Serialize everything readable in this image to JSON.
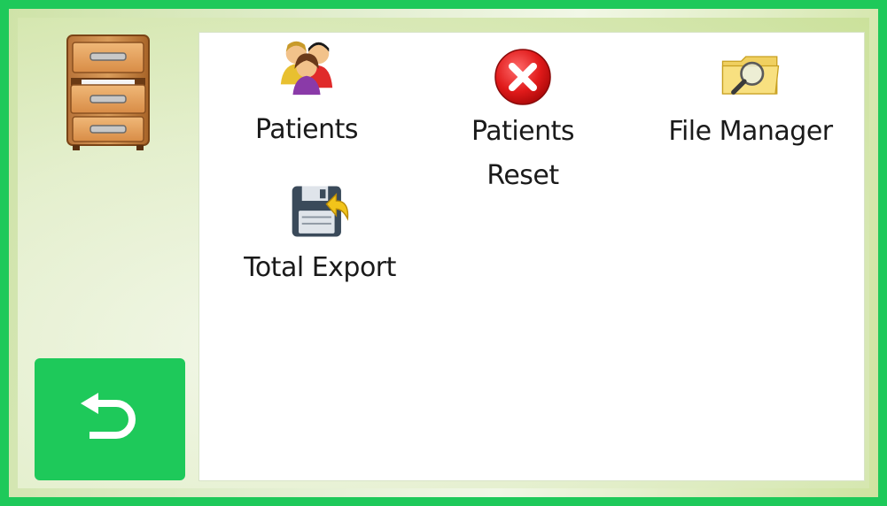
{
  "apps": [
    {
      "label": "Patients",
      "icon": "patients-group-icon"
    },
    {
      "label": "Patients\nReset",
      "icon": "red-x-icon"
    },
    {
      "label": "File Manager",
      "icon": "folder-search-icon"
    },
    {
      "label": "Total Export",
      "icon": "floppy-export-icon"
    }
  ],
  "sidebar": {
    "icon": "file-cabinet-icon",
    "back_icon": "back-arrow-icon"
  },
  "colors": {
    "accent": "#1ec95a",
    "panel": "#ffffff",
    "text": "#1a1a1a"
  }
}
